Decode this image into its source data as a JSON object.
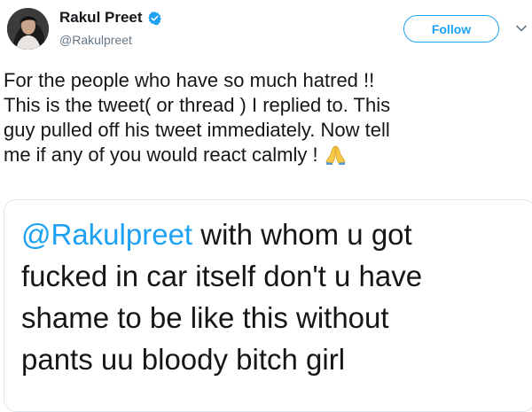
{
  "author": {
    "display_name": "Rakul Preet",
    "handle": "@Rakulpreet",
    "verified": true
  },
  "header": {
    "follow_label": "Follow",
    "menu_icon": "chevron-down-icon"
  },
  "tweet": {
    "lines": [
      "For the people who have so much hatred !!",
      "This is the tweet( or thread ) I replied to. This",
      "guy pulled off his tweet immediately. Now tell",
      "me if any of you would react calmly !"
    ],
    "emoji": "folded-hands-icon"
  },
  "quoted_image": {
    "mention": "@Rakulpreet",
    "line1_rest": " with whom u got",
    "lines": [
      "fucked in car itself don't u have",
      "shame to be like this without",
      "pants uu bloody bitch girl"
    ]
  },
  "colors": {
    "accent": "#1da1f2",
    "text": "#14171a",
    "muted": "#657786",
    "border": "#e1e8ed"
  }
}
